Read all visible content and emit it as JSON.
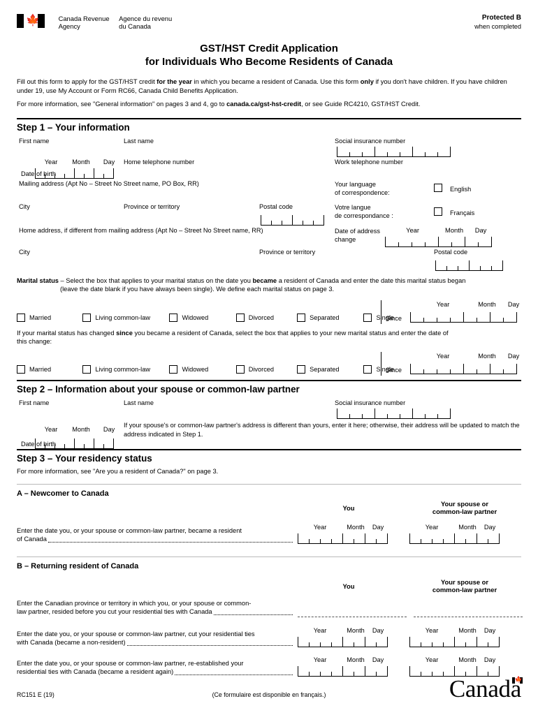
{
  "header": {
    "agency_en_line1": "Canada Revenue",
    "agency_en_line2": "Agency",
    "agency_fr_line1": "Agence du revenu",
    "agency_fr_line2": "du Canada",
    "protected_label": "Protected B",
    "protected_sub": "when completed",
    "flag_icon": "canada-flag-icon"
  },
  "title": {
    "line1": "GST/HST Credit Application",
    "line2": "for Individuals Who Become Residents of Canada"
  },
  "intro": {
    "p1_a": "Fill out this form to apply for the GST/HST credit ",
    "p1_b": "for the year",
    "p1_c": " in which you became a resident of Canada. Use this form ",
    "p1_d": "only",
    "p1_e": " if you don't have children. If you have children under 19, use My Account or Form RC66, Canada Child Benefits Application.",
    "p2_a": "For more information, see \"General information\" on pages 3 and 4, go to ",
    "p2_b": "canada.ca/gst-hst-credit",
    "p2_c": ", or see Guide RC4210, GST/HST Credit."
  },
  "step1": {
    "heading": "Step 1 – Your information",
    "first_name": "First name",
    "last_name": "Last name",
    "sin": "Social insurance number",
    "year": "Year",
    "month": "Month",
    "day": "Day",
    "date_of_birth": "Date of birth",
    "home_phone": "Home telephone number",
    "work_phone": "Work telephone number",
    "mailing_address": "Mailing address (Apt No – Street No Street name, PO Box, RR)",
    "city": "City",
    "province": "Province or territory",
    "postal_code": "Postal code",
    "lang_en_line1": "Your language",
    "lang_en_line2": "of correspondence:",
    "lang_en_option": "English",
    "lang_fr_line1": "Votre langue",
    "lang_fr_line2": "de correspondance :",
    "lang_fr_option": "Français",
    "home_address": "Home address, if different from mailing address (Apt No – Street No Street name, RR)",
    "date_addr_change_line1": "Date of address",
    "date_addr_change_line2": "change",
    "city2": "City",
    "province2": "Province or territory",
    "postal_code2": "Postal code",
    "marital_label": "Marital status",
    "marital_intro_a": " – Select the box that applies to your marital status on the date you ",
    "marital_intro_b": "became",
    "marital_intro_c": " a resident of Canada and enter the date this marital status began",
    "marital_intro_line2": "(leave the date blank if you have always been single). We define each marital status on page 3.",
    "marital_options": [
      "Married",
      "Living common-law",
      "Widowed",
      "Divorced",
      "Separated",
      "Single"
    ],
    "since": "Since",
    "changed_a": "If your marital status has changed ",
    "changed_b": "since",
    "changed_c": " you became a resident of Canada, select the box that applies to your new marital status and enter the date of",
    "changed_line2": "this change:"
  },
  "step2": {
    "heading": "Step 2 – Information about your spouse or common-law partner",
    "first_name": "First name",
    "last_name": "Last name",
    "sin": "Social insurance number",
    "year": "Year",
    "month": "Month",
    "day": "Day",
    "date_of_birth": "Date of birth",
    "note_line1": "If your spouse's or common-law partner's address is different than yours, enter it here; otherwise, their address",
    "note_line2": "will be updated to match the address indicated in Step 1."
  },
  "step3": {
    "heading": "Step 3 – Your residency status",
    "subtitle": "For more information, see \"Are you a resident of Canada?\" on page 3.",
    "col_you": "You",
    "col_spouse_line1": "Your spouse or",
    "col_spouse_line2": "common-law partner",
    "year": "Year",
    "month": "Month",
    "day": "Day",
    "section_a": {
      "heading": "A – Newcomer to Canada",
      "q_line1": "Enter the date you, or your spouse or common-law partner, became a resident",
      "q_line2": "of Canada"
    },
    "section_b": {
      "heading": "B – Returning resident of Canada",
      "q1_line1": "Enter the Canadian province or territory in which you, or your spouse or common-",
      "q1_line2": "law partner, resided before you cut your residential ties with Canada",
      "q2_line1": "Enter the date you, or your spouse or common-law partner, cut your residential ties",
      "q2_line2": "with Canada (became a non-resident)",
      "q3_line1": "Enter the date you, or your spouse or common-law partner, re-established your",
      "q3_line2": "residential ties with Canada (became a resident again)"
    }
  },
  "footer": {
    "form_code": "RC151 E (19)",
    "french_note": "(Ce formulaire est disponible en français.)",
    "wordmark": "Canada",
    "wordmark_flag_icon": "canada-flag-icon"
  }
}
